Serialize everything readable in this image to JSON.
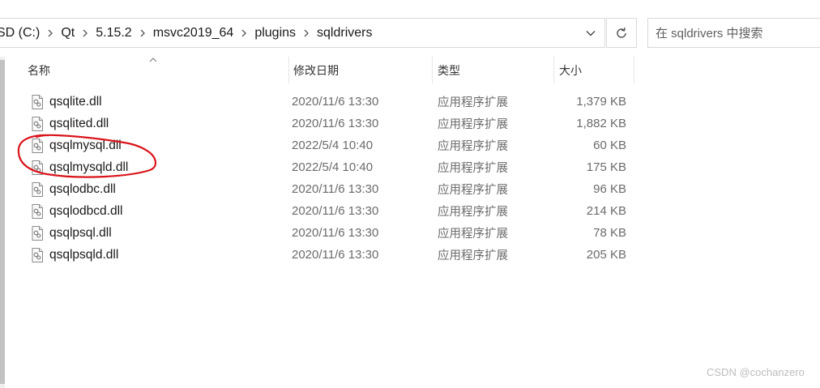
{
  "address_bar": {
    "breadcrumbs": [
      "SD (C:)",
      "Qt",
      "5.15.2",
      "msvc2019_64",
      "plugins",
      "sqldrivers"
    ]
  },
  "search": {
    "placeholder": "在 sqldrivers 中搜索"
  },
  "columns": {
    "name": "名称",
    "date": "修改日期",
    "type": "类型",
    "size": "大小"
  },
  "files": [
    {
      "name": "qsqlite.dll",
      "date": "2020/11/6 13:30",
      "type": "应用程序扩展",
      "size": "1,379 KB"
    },
    {
      "name": "qsqlited.dll",
      "date": "2020/11/6 13:30",
      "type": "应用程序扩展",
      "size": "1,882 KB"
    },
    {
      "name": "qsqlmysql.dll",
      "date": "2022/5/4 10:40",
      "type": "应用程序扩展",
      "size": "60 KB"
    },
    {
      "name": "qsqlmysqld.dll",
      "date": "2022/5/4 10:40",
      "type": "应用程序扩展",
      "size": "175 KB"
    },
    {
      "name": "qsqlodbc.dll",
      "date": "2020/11/6 13:30",
      "type": "应用程序扩展",
      "size": "96 KB"
    },
    {
      "name": "qsqlodbcd.dll",
      "date": "2020/11/6 13:30",
      "type": "应用程序扩展",
      "size": "214 KB"
    },
    {
      "name": "qsqlpsql.dll",
      "date": "2020/11/6 13:30",
      "type": "应用程序扩展",
      "size": "78 KB"
    },
    {
      "name": "qsqlpsqld.dll",
      "date": "2020/11/6 13:30",
      "type": "应用程序扩展",
      "size": "205 KB"
    }
  ],
  "icons": {
    "file": "dll-file-icon",
    "separator": "chevron-right-icon",
    "dropdown": "chevron-down-icon",
    "refresh": "refresh-icon"
  },
  "colors": {
    "annotation": "#d9141b",
    "secondary_text": "#6b6b6b"
  },
  "watermark": "CSDN @cochanzero"
}
